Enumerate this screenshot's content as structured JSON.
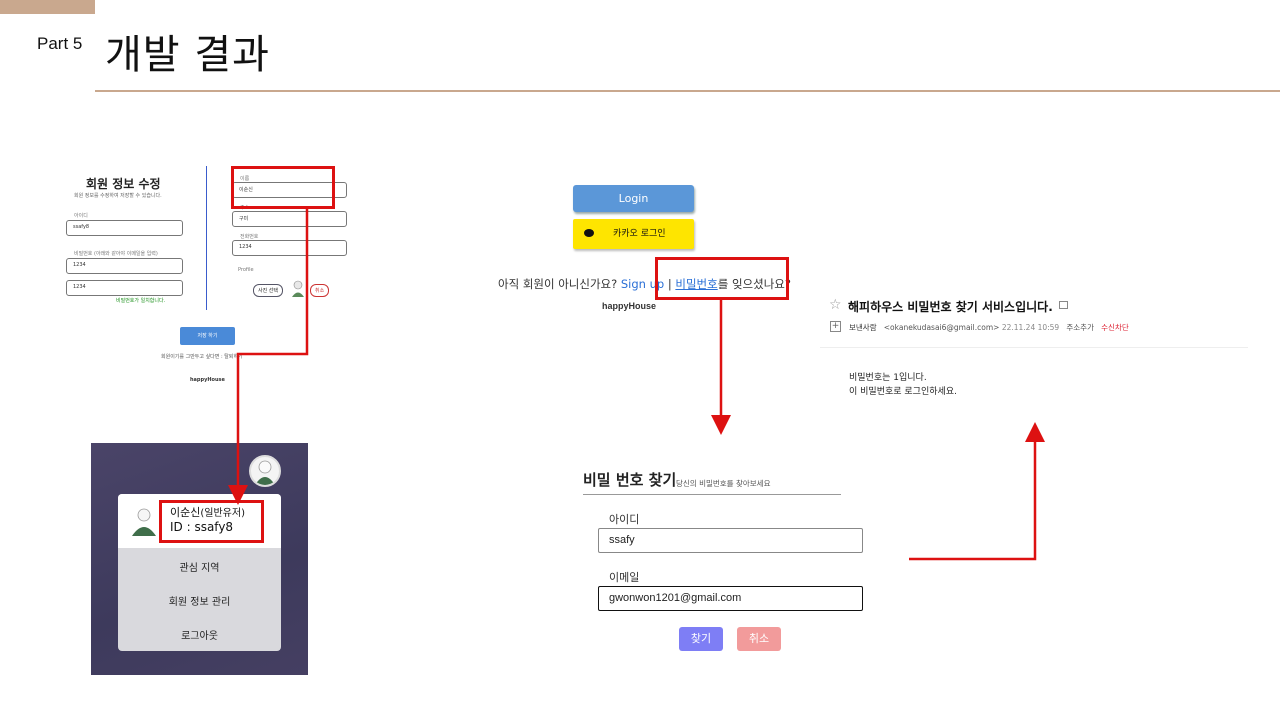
{
  "header": {
    "part": "Part 5",
    "title": "개발 결과"
  },
  "edit_panel": {
    "title": "회원 정보 수정",
    "subtitle": "회원 정보를 수정하여 저장할 수 있습니다.",
    "id_label": "아이디",
    "id_value": "ssafy8",
    "pw_label": "비밀번호 (아래와 같아야 이메일을 입력)",
    "pw_value": "1234",
    "pw_confirm_value": "1234",
    "pw_match": "비밀번호가 일치합니다.",
    "name_label": "이름",
    "name_value": "이순신",
    "region_label": "주소",
    "region_value": "구미",
    "phone_label": "전화번호",
    "phone_value": "1234",
    "profile_label": "Profile",
    "photo_button": "사진 선택",
    "cancel_button": "취소",
    "save_button": "저장 하기",
    "quit_text": "회원이기를 그만두고 싶다면 : 탈퇴하기",
    "brand": "happyHouse"
  },
  "profile_menu": {
    "name": "이순신",
    "role": "(일반유저)",
    "id_line": "ID : ssafy8",
    "items": [
      "관심 지역",
      "회원 정보 관리",
      "로그아웃"
    ]
  },
  "login_panel": {
    "login_button": "Login",
    "kakao_button": "카카오 로그인",
    "question_prefix": "아직 회원이 아니신가요? ",
    "signup_link": "Sign up",
    "separator": " | ",
    "find_pw_link": "비밀번호",
    "question_suffix": "를 잊으셨나요?",
    "brand": "happyHouse"
  },
  "email_panel": {
    "subject": "해피하우스 비밀번호 찾기 서비스입니다.",
    "sender_label": "보낸사람",
    "sender_email": "<okanekudasai6@gmail.com>",
    "date": "22.11.24 10:59",
    "add_contact": "주소추가",
    "block": "수신차단",
    "body_line1": "비밀번호는 1입니다.",
    "body_line2": "이 비밀번호로 로그인하세요."
  },
  "find_pw_panel": {
    "title": "비밀 번호 찾기",
    "subtitle": "당신의 비밀번호를 찾아보세요",
    "id_label": "아이디",
    "id_value": "ssafy",
    "email_label": "이메일",
    "email_value": "gwonwon1201@gmail.com",
    "find_button": "찾기",
    "cancel_button": "취소"
  },
  "colors": {
    "accent": "#c9a88e",
    "highlight": "#dd1111",
    "login_blue": "#5b97d8",
    "kakao_yellow": "#fee500",
    "find_purple": "#7e7ef5",
    "cancel_pink": "#f29b9b"
  }
}
